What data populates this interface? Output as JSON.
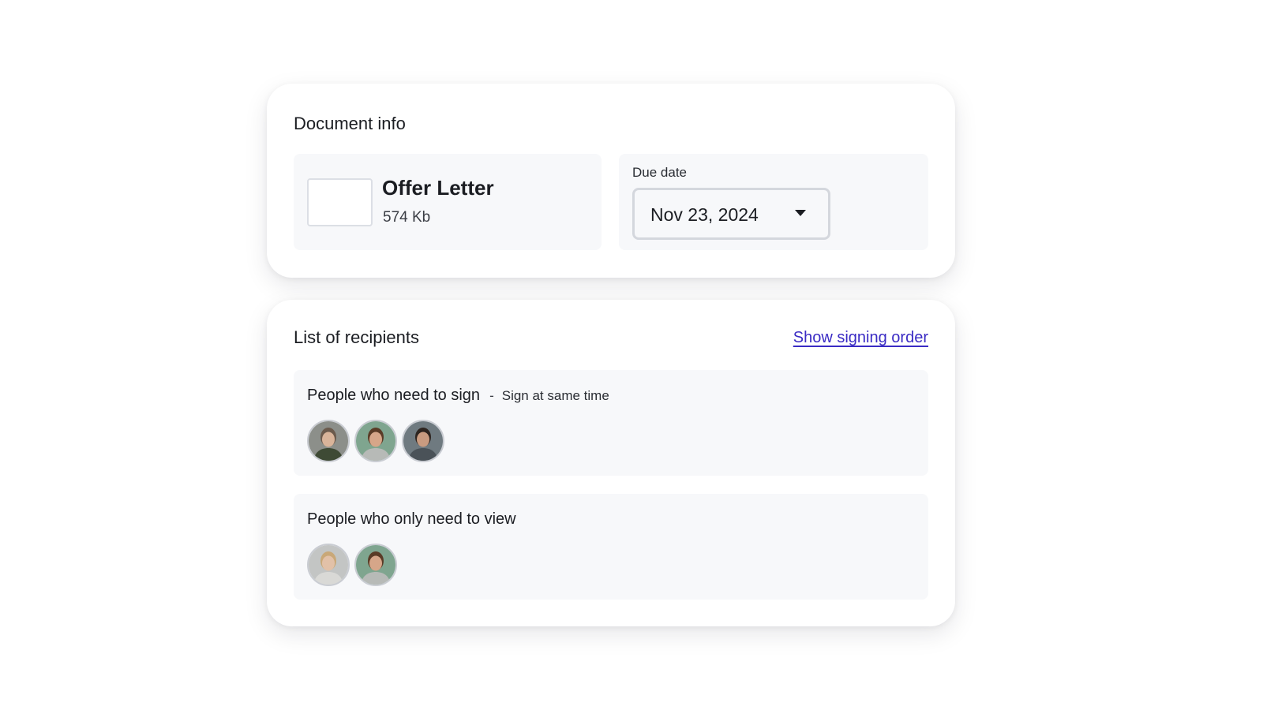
{
  "document_info": {
    "title": "Document info",
    "file": {
      "name": "Offer Letter",
      "size": "574 Kb"
    },
    "due_date": {
      "label": "Due date",
      "value": "Nov 23, 2024"
    }
  },
  "recipients": {
    "title": "List of recipients",
    "show_signing_order": "Show signing order",
    "signers": {
      "title": "People who need to sign",
      "separator": "-",
      "note": "Sign at same time",
      "avatars": [
        {
          "icon": "person-avatar-icon",
          "bg": "#8c8f8a",
          "skin": "#d9b49a",
          "hair": "#6b5a4c",
          "shirt": "#3e4a35"
        },
        {
          "icon": "person-avatar-icon",
          "bg": "#7fa58f",
          "skin": "#d6a689",
          "hair": "#5a3b26",
          "shirt": "#b7bab7"
        },
        {
          "icon": "person-avatar-icon",
          "bg": "#6f7a80",
          "skin": "#c99b80",
          "hair": "#2e2520",
          "shirt": "#4a5258"
        }
      ]
    },
    "viewers": {
      "title": "People who only need to view",
      "avatars": [
        {
          "icon": "person-avatar-icon",
          "bg": "#c3c5c4",
          "skin": "#e2c1a8",
          "hair": "#c9a878",
          "shirt": "#d9d9d6"
        },
        {
          "icon": "person-avatar-icon",
          "bg": "#7fa58f",
          "skin": "#d6a689",
          "hair": "#5a3b26",
          "shirt": "#b7bab7"
        }
      ]
    }
  },
  "colors": {
    "link": "#3a2bc4",
    "panel_bg": "#f7f8fa"
  }
}
